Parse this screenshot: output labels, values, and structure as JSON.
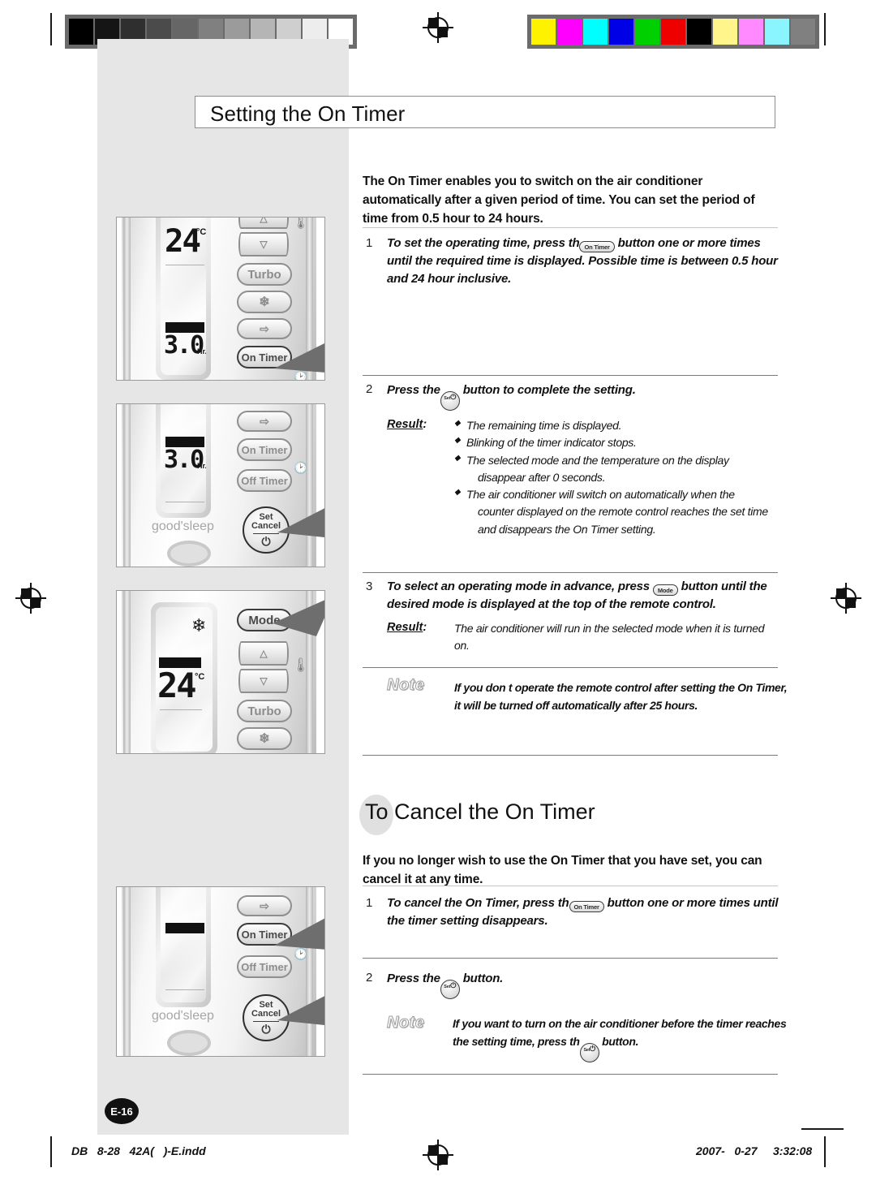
{
  "page": {
    "title": "Setting the On Timer",
    "page_number": "E-16",
    "footer_left": "DB   8-28   42A(   )-E.indd",
    "footer_right": "2007-   0-27     3:32:08"
  },
  "calibration": {
    "grayscale_patches": [
      "#000000",
      "#151515",
      "#2f2f2f",
      "#4b4b4b",
      "#666666",
      "#808080",
      "#9b9b9b",
      "#b5b5b5",
      "#cfcfcf",
      "#ededed",
      "#ffffff"
    ],
    "color_patches": [
      "#fff200",
      "#ff00ff",
      "#00ffff",
      "#0000e6",
      "#00d000",
      "#ee0000",
      "#000000",
      "#fff58a",
      "#ff8aff",
      "#8af5ff",
      "#808080"
    ]
  },
  "intro": {
    "text": "The On Timer enables you to switch on the air conditioner automatically after a given period of time. You can set the period of time from 0.5 hour to 24 hours."
  },
  "steps": [
    {
      "number": "1",
      "text_before": "To set the operating time, press th",
      "key": "On Timer",
      "text_after": " button one or more times until the required time is displayed. Possible time is between 0.5 hour and 24 hour inclusive."
    },
    {
      "number": "2",
      "text_before": "Press the",
      "key": "Set / Cancel",
      "text_after": " button to complete the setting."
    },
    {
      "number": "3",
      "text_before": "To select an operating mode in advance, press ",
      "key": "Mode",
      "text_after": " button until the desired mode is displayed at the top of the remote control."
    }
  ],
  "result_step2": {
    "label": "Result",
    "bullets": [
      "The remaining time is displayed.",
      "Blinking of the timer indicator stops.",
      "The selected mode and the temperature on the display",
      "The air conditioner will switch on automatically when the"
    ],
    "continuations": {
      "bullet3": "disappear after    0 seconds.",
      "bullet4_line1": "counter displayed on the remote control reaches the set time",
      "bullet4_line2": "and disappears the On Timer setting."
    }
  },
  "result_step3": {
    "label": "Result",
    "text": "The air conditioner will run in the selected mode when it is turned on."
  },
  "note_top": {
    "label": "Note",
    "text": "If you don   t operate the remote control after setting the On Timer, it will be turned off automatically after 25 hours."
  },
  "cancel_section": {
    "heading_first": "To",
    "heading_rest": " Cancel the On Timer",
    "intro": "If you no longer wish to use the On Timer that you have set, you can cancel it at any time.",
    "steps": [
      {
        "number": "1",
        "text_before": "To cancel the On Timer, press th",
        "key": "On Timer",
        "text_after": " button one or more times until the timer setting disappears."
      },
      {
        "number": "2",
        "text_before": "Press the",
        "key": "Set / Cancel",
        "text_after": " button."
      }
    ],
    "note": {
      "label": "Note",
      "line1_before": "If you want to turn on the air conditioner before the timer reaches",
      "line2_before": "the setting time, press th",
      "line2_key": "Set / Cancel",
      "line2_after": " button."
    }
  },
  "figures": [
    {
      "id": "fig-1",
      "lcd_temperature": "24",
      "lcd_temperature_unit": "°C",
      "lcd_timer": "3.0",
      "lcd_timer_unit": "Hr.",
      "buttons": [
        "△",
        "▽",
        "Turbo",
        "fan-icon",
        "swing-icon",
        "On Timer"
      ],
      "highlighted": "On Timer"
    },
    {
      "id": "fig-2",
      "lcd_timer": "3.0",
      "lcd_timer_unit": "Hr.",
      "sleep_label": "good'sleep",
      "buttons": [
        "swing-icon",
        "On Timer",
        "Off Timer",
        "Set Cancel"
      ],
      "highlighted": "Set Cancel",
      "set_label_top": "Set",
      "set_label_bottom": "Cancel"
    },
    {
      "id": "fig-3",
      "mode_icon": "snowflake",
      "lcd_temperature": "24",
      "lcd_temperature_unit": "°C",
      "buttons": [
        "Mode",
        "△",
        "▽",
        "Turbo",
        "fan-icon"
      ],
      "highlighted": "Mode"
    },
    {
      "id": "fig-4",
      "sleep_label": "good'sleep",
      "buttons": [
        "swing-icon",
        "On Timer",
        "Off Timer",
        "Set Cancel"
      ],
      "highlighted": "On Timer, Set Cancel",
      "set_label_top": "Set",
      "set_label_bottom": "Cancel"
    }
  ]
}
